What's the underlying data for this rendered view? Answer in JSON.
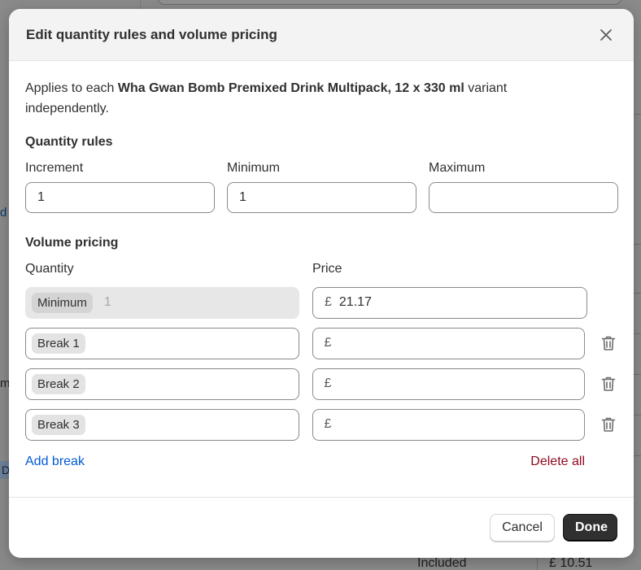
{
  "background": {
    "left_fragments": [
      "d",
      "m",
      "D"
    ],
    "bottom_row": {
      "label": "Included",
      "price": "£ 10.51"
    }
  },
  "modal": {
    "title": "Edit quantity rules and volume pricing",
    "applies": {
      "prefix": "Applies to each ",
      "product": "Wha Gwan Bomb Premixed Drink Multipack, 12 x 330 ml",
      "suffix": " variant independently."
    },
    "quantity_rules": {
      "title": "Quantity rules",
      "increment": {
        "label": "Increment",
        "value": "1"
      },
      "minimum": {
        "label": "Minimum",
        "value": "1"
      },
      "maximum": {
        "label": "Maximum",
        "value": ""
      }
    },
    "volume_pricing": {
      "title": "Volume pricing",
      "quantity_header": "Quantity",
      "price_header": "Price",
      "currency": "£",
      "rows": [
        {
          "chip": "Minimum",
          "qty": "1",
          "price": "21.17"
        },
        {
          "chip": "Break 1",
          "qty": "",
          "price": ""
        },
        {
          "chip": "Break 2",
          "qty": "",
          "price": ""
        },
        {
          "chip": "Break 3",
          "qty": "",
          "price": ""
        }
      ],
      "add_break": "Add break",
      "delete_all": "Delete all"
    },
    "footer": {
      "cancel": "Cancel",
      "done": "Done"
    }
  },
  "colors": {
    "link": "#005bd3",
    "critical": "#8e0b21",
    "primary_button": "#303030"
  },
  "icons": {
    "close": "close-icon",
    "delete": "trash-icon"
  }
}
